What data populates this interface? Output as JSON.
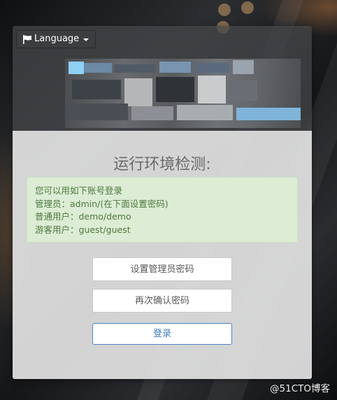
{
  "language_button": {
    "label": "Language"
  },
  "title": "运行环境检测:",
  "notice": {
    "lines": [
      "您可以用如下账号登录",
      "管理员：admin/(在下面设置密码)",
      "普通用户：demo/demo",
      "游客用户：guest/guest"
    ]
  },
  "form": {
    "password_placeholder": "设置管理员密码",
    "confirm_placeholder": "再次确认密码",
    "login_label": "登录"
  },
  "watermark": "@51CTO博客",
  "colors": {
    "notice_bg": "#dcecd5",
    "notice_text": "#4d7a3d",
    "login_border": "#4a86c8"
  }
}
